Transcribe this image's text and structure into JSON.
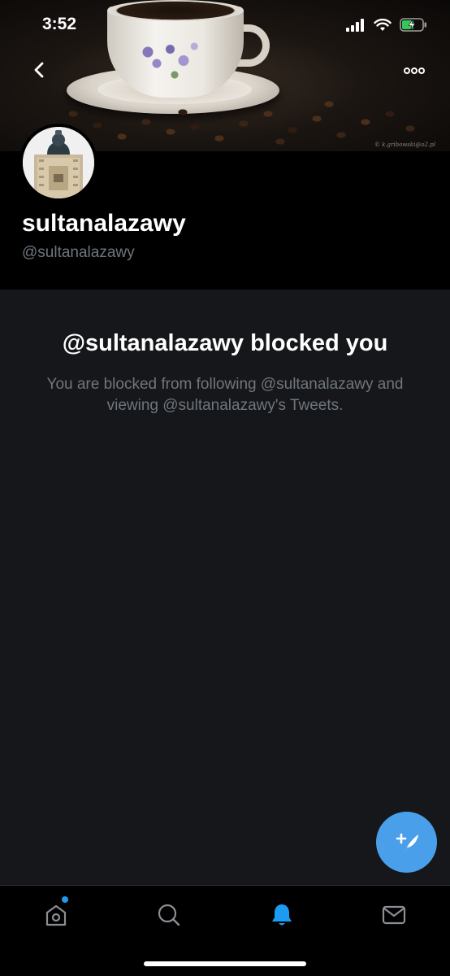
{
  "status_bar": {
    "time": "3:52",
    "icons": [
      "cellular-signal-icon",
      "wifi-icon",
      "battery-charging-icon"
    ]
  },
  "banner": {
    "watermark": "© k.gribowski@o2.pl"
  },
  "nav": {
    "back_icon": "chevron-left-icon",
    "more_icon": "more-horizontal-icon"
  },
  "profile": {
    "display_name": "sultanalazawy",
    "handle": "@sultanalazawy"
  },
  "blocked": {
    "title": "@sultanalazawy blocked you",
    "message": "You are blocked from following @sultanalazawy and viewing @sultanalazawy's Tweets."
  },
  "fab": {
    "icon": "compose-tweet-icon"
  },
  "tabs": [
    {
      "name": "home",
      "icon": "home-icon",
      "active": false,
      "has_notification_dot": true
    },
    {
      "name": "search",
      "icon": "search-icon",
      "active": false
    },
    {
      "name": "notifications",
      "icon": "bell-icon",
      "active": true
    },
    {
      "name": "messages",
      "icon": "mail-icon",
      "active": false
    }
  ],
  "colors": {
    "accent": "#1d9bf0",
    "fab": "#4a9fea",
    "secondary_text": "#6e767d",
    "background": "#16171a"
  }
}
